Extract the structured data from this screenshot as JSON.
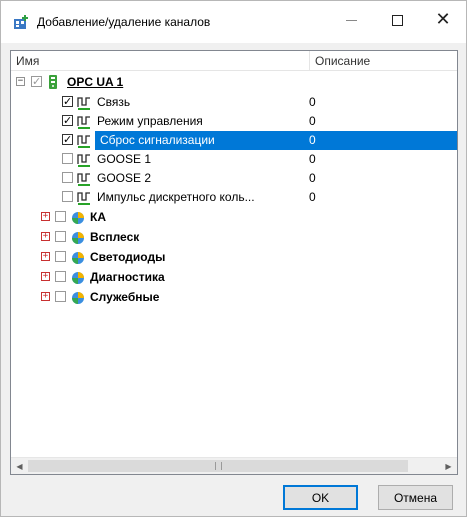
{
  "window": {
    "title": "Добавление/удаление каналов",
    "minimize_icon": "minimize-icon",
    "maximize_icon": "maximize-icon",
    "close_icon": "close-icon"
  },
  "columns": {
    "name": "Имя",
    "description": "Описание"
  },
  "tree": {
    "root": {
      "label": "OPC UA 1",
      "expanded": true,
      "checked": "partial",
      "icon": "server-icon"
    },
    "channels": [
      {
        "label": "Связь",
        "value": "0",
        "checked": true,
        "icon": "signal-icon",
        "selected": false
      },
      {
        "label": "Режим управления",
        "value": "0",
        "checked": true,
        "icon": "signal-icon",
        "selected": false
      },
      {
        "label": "Сброс сигнализации",
        "value": "0",
        "checked": true,
        "icon": "signal-icon",
        "selected": true
      },
      {
        "label": "GOOSE 1",
        "value": "0",
        "checked": false,
        "icon": "signal-icon",
        "selected": false
      },
      {
        "label": "GOOSE 2",
        "value": "0",
        "checked": false,
        "icon": "signal-icon",
        "selected": false
      },
      {
        "label": "Импульс дискретного коль...",
        "value": "0",
        "checked": false,
        "icon": "signal-icon",
        "selected": false
      }
    ],
    "groups": [
      {
        "label": "КА",
        "expanded": false,
        "checked": false,
        "icon": "group-globe-icon"
      },
      {
        "label": "Всплеск",
        "expanded": false,
        "checked": false,
        "icon": "group-globe-icon"
      },
      {
        "label": "Светодиоды",
        "expanded": false,
        "checked": false,
        "icon": "group-globe-icon"
      },
      {
        "label": "Диагностика",
        "expanded": false,
        "checked": false,
        "icon": "group-globe-icon"
      },
      {
        "label": "Служебные",
        "expanded": false,
        "checked": false,
        "icon": "group-globe-icon"
      }
    ]
  },
  "buttons": {
    "ok": "OK",
    "cancel": "Отмена"
  },
  "colors": {
    "selection": "#0078d7",
    "window_bg": "#f0f0f0"
  }
}
